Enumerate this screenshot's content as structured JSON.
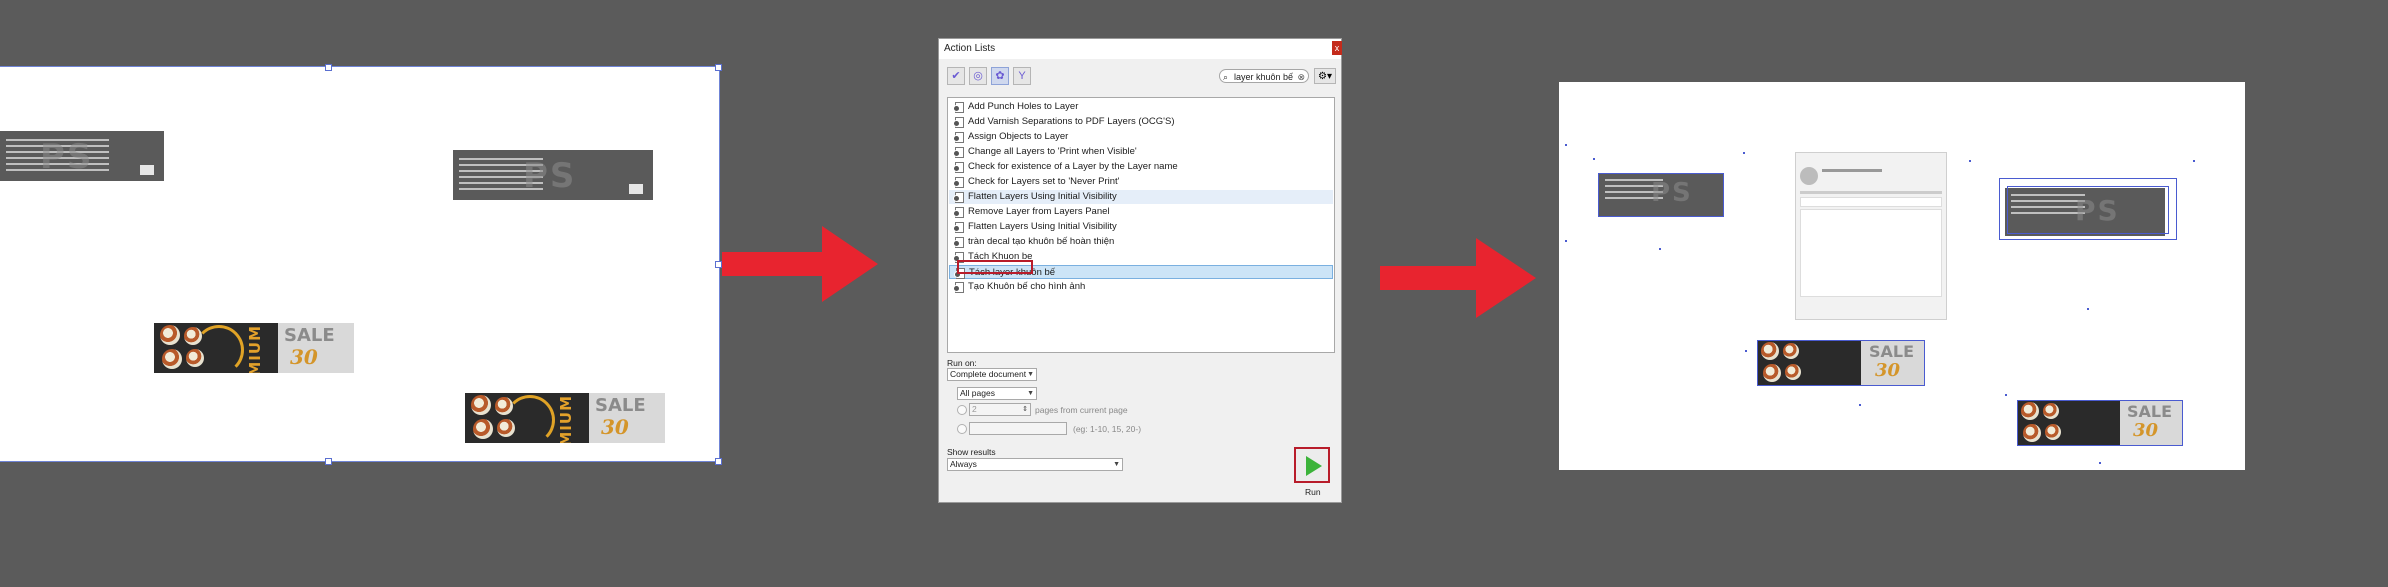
{
  "dialog": {
    "title": "Action Lists",
    "close": "x",
    "search_value": "layer khuôn bế",
    "search_icon": "magnifier-icon",
    "gear": "⚙",
    "actions": [
      "Add Punch Holes to Layer",
      "Add Varnish Separations to PDF Layers (OCG'S)",
      "Assign Objects to Layer",
      "Change all Layers to 'Print when Visible'",
      "Check for existence of a Layer by the Layer name",
      "Check for Layers set to 'Never Print'",
      "Flatten Layers Using Initial Visibility",
      "Remove Layer from Layers Panel",
      "Flatten Layers Using Initial Visibility",
      "tràn decal tạo khuôn bế hoàn thiện",
      "Tách Khuon be",
      "Tách layer khuôn bế",
      "Tạo Khuôn bế cho hình ảnh"
    ],
    "highlighted_index": 6,
    "selected_index": 11,
    "run_on_label": "Run on:",
    "run_on_value": "Complete document",
    "pages_value": "All pages",
    "pages_count": "2",
    "pages_from_label": "pages from current page",
    "range_hint": "(eg: 1-10, 15, 20-)",
    "show_results_label": "Show results",
    "show_results_value": "Always",
    "run_label": "Run"
  },
  "left_canvas": {
    "watermark": "PS",
    "banner_sale": "SALE",
    "banner_pct": "30",
    "banner_vertical": "PREMIUM"
  },
  "right_canvas": {
    "watermark": "PS",
    "banner_sale": "SALE",
    "banner_pct": "30"
  },
  "colors": {
    "arrow": "#e8242f",
    "background": "#5b5b5b",
    "selection": "#4a5bd0",
    "highlight_box": "#b81c2a"
  }
}
